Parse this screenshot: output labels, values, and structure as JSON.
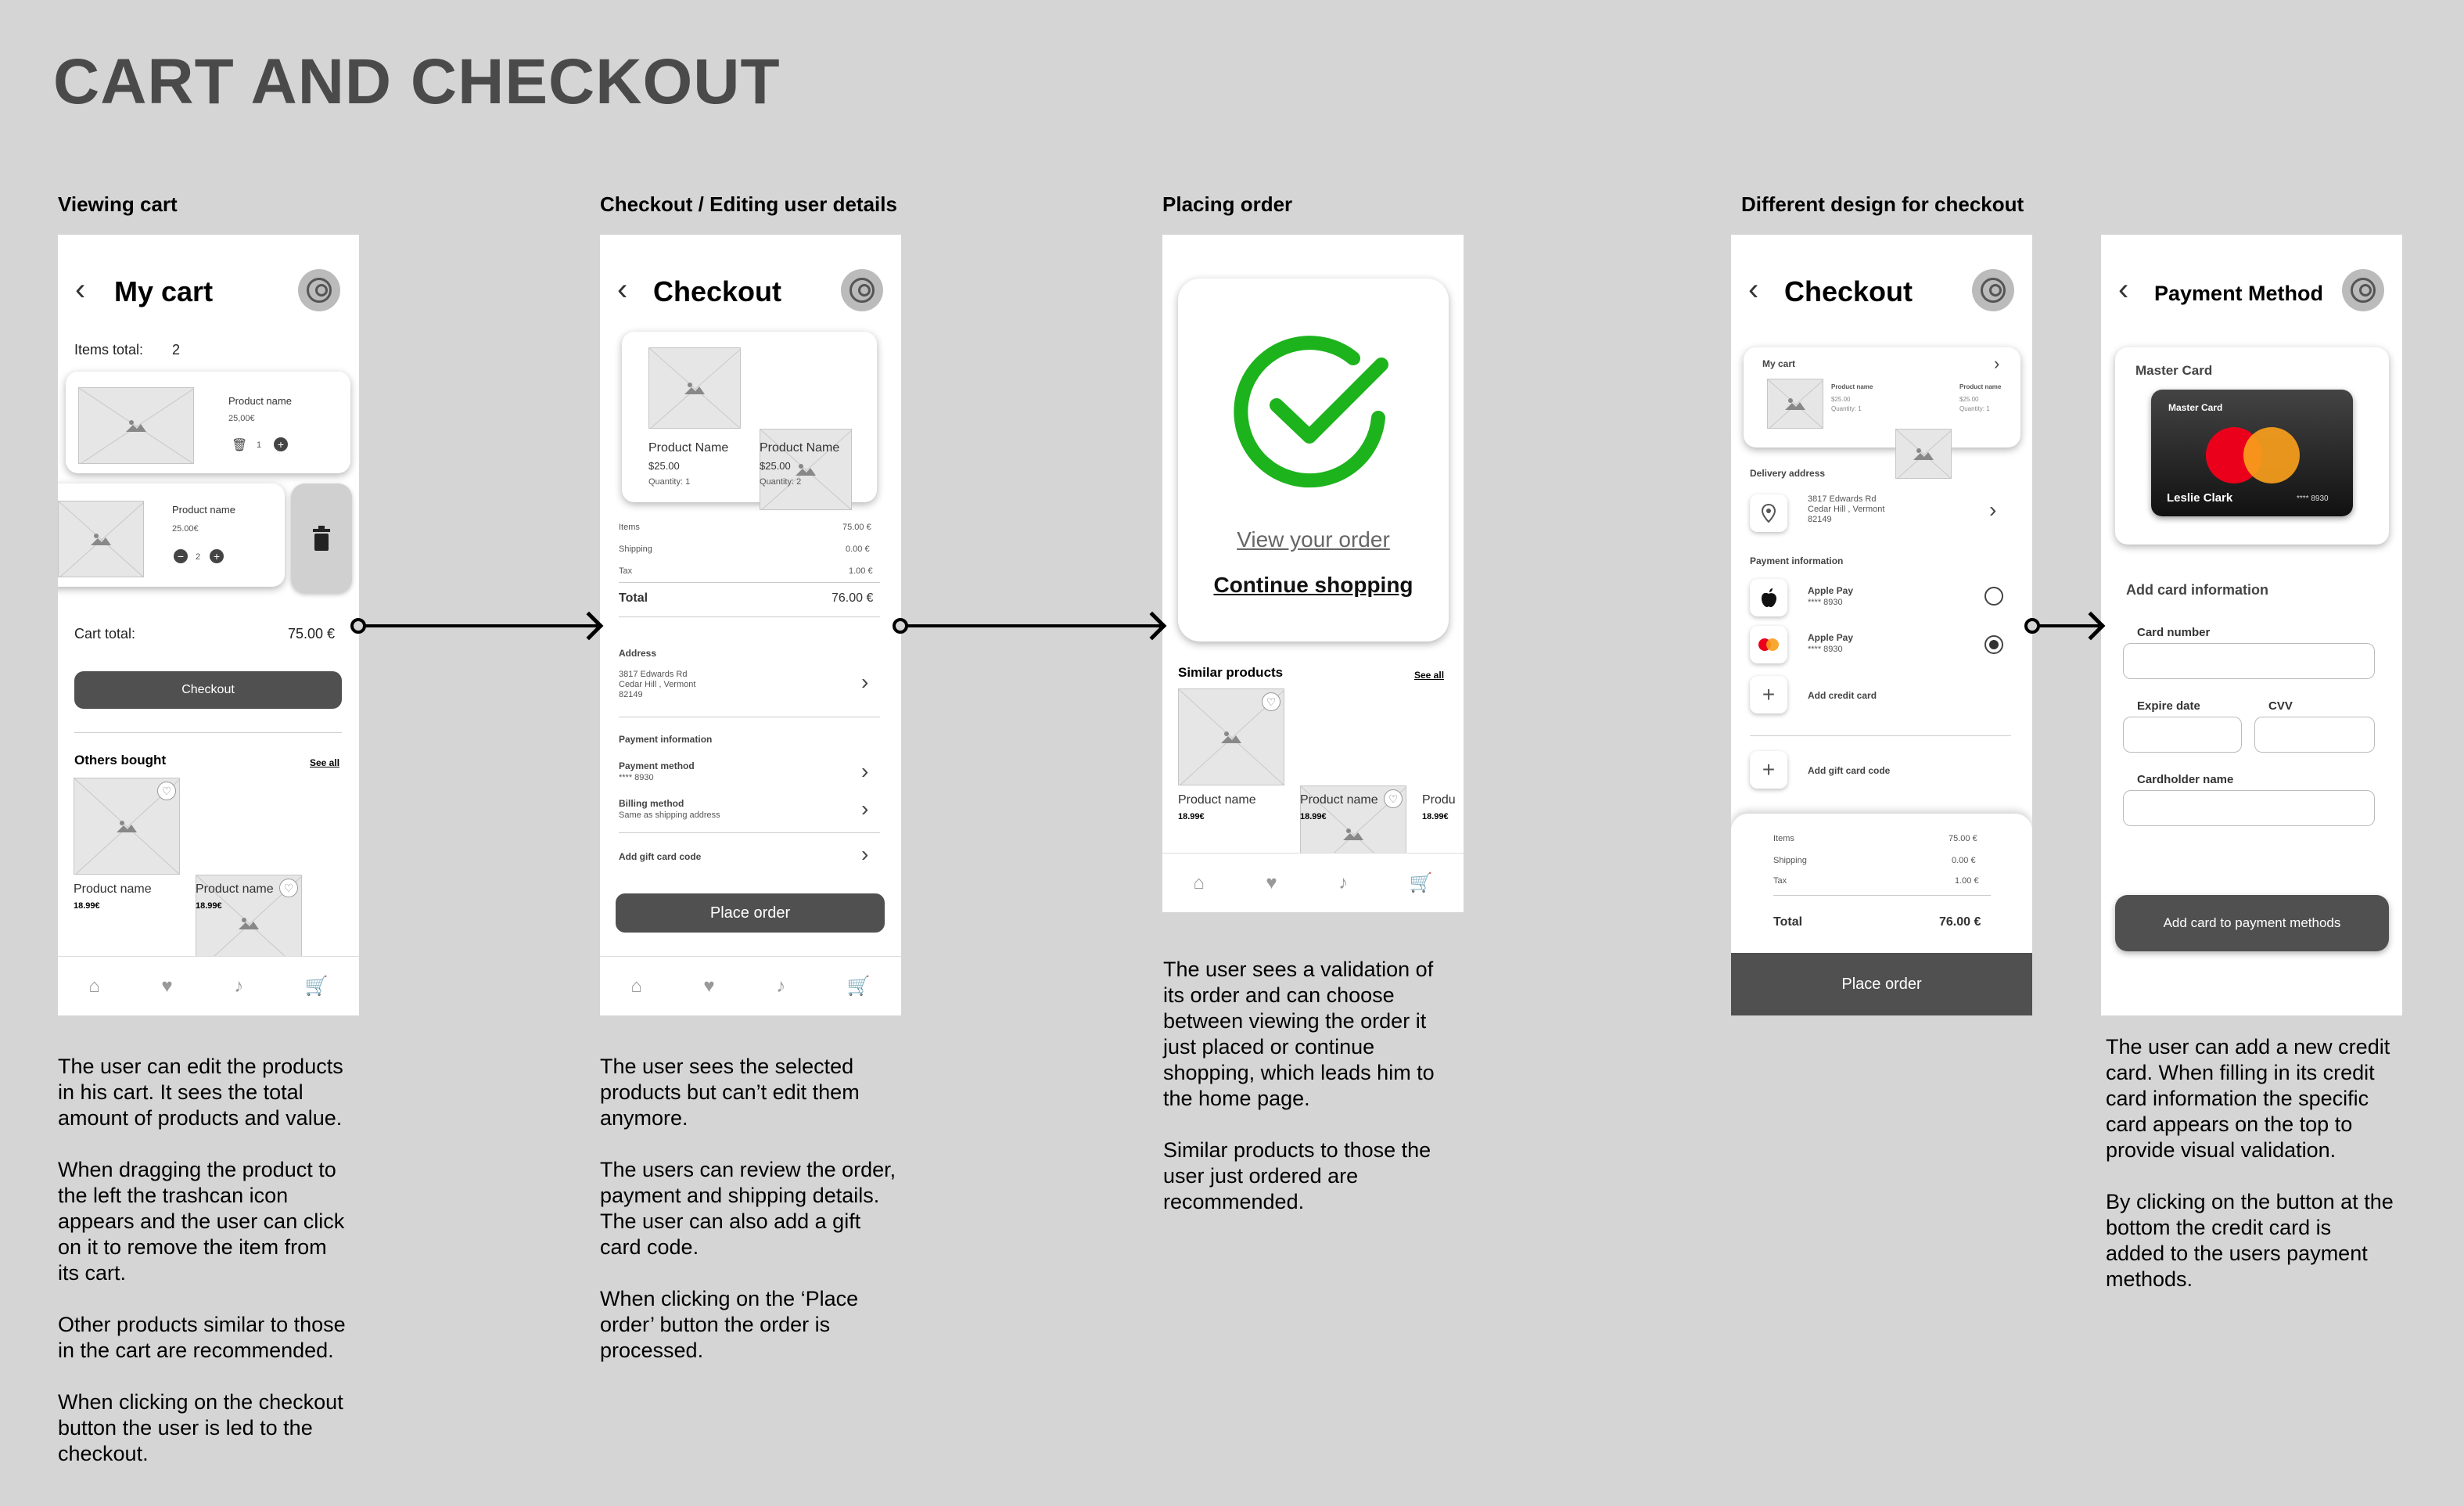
{
  "title": "CART AND CHECKOUT",
  "columns": {
    "c1": "Viewing cart",
    "c2": "Checkout / Editing user details",
    "c3": "Placing order",
    "c4": "Different design for checkout"
  },
  "cart": {
    "title": "My cart",
    "items_total_label": "Items total:",
    "items_total_value": "2",
    "item1": {
      "name": "Product name",
      "price": "25,00€",
      "qty": "1"
    },
    "item2": {
      "name": "Product name",
      "price": "25.00€",
      "qty": "2"
    },
    "cart_total_label": "Cart total:",
    "cart_total_value": "75.00 €",
    "checkout_button": "Checkout",
    "others_bought": "Others bought",
    "see_all": "See all",
    "rec1": {
      "name": "Product name",
      "price": "18.99€"
    },
    "rec2": {
      "name": "Product name",
      "price": "18.99€"
    }
  },
  "checkout": {
    "title": "Checkout",
    "p1": {
      "name": "Product Name",
      "price": "$25.00",
      "qty": "Quantity:  1"
    },
    "p2": {
      "name": "Product Name",
      "price": "$25.00",
      "qty": "Quantity:  2"
    },
    "items_label": "Items",
    "items_value": "75.00 €",
    "shipping_label": "Shipping",
    "shipping_value": "0.00 €",
    "tax_label": "Tax",
    "tax_value": "1.00 €",
    "total_label": "Total",
    "total_value": "76.00 €",
    "address_label": "Address",
    "address_lines": "3817 Edwards Rd\nCedar Hill , Vermont\n82149",
    "payment_info_label": "Payment information",
    "payment_method_label": "Payment method",
    "payment_method_value": "**** 8930",
    "billing_label": "Billing method",
    "billing_value": "Same as shipping address",
    "gift_label": "Add gift card code",
    "place_order": "Place order"
  },
  "placing": {
    "view_order": "View your order",
    "continue_shopping": "Continue shopping",
    "similar_label": "Similar products",
    "see_all": "See all",
    "s1": {
      "name": "Product name",
      "price": "18.99€"
    },
    "s2": {
      "name": "Product name",
      "price": "18.99€"
    },
    "s3": {
      "name": "Produ",
      "price": "18.99€"
    }
  },
  "checkout2": {
    "title": "Checkout",
    "my_cart": "My cart",
    "mini1": {
      "name": "Product name",
      "price": "$25.00",
      "qty": "Quantity:  1"
    },
    "mini2": {
      "name": "Product name",
      "price": "$25.00",
      "qty": "Quantity:  1"
    },
    "delivery_label": "Delivery address",
    "address_lines": "3817 Edwards Rd\nCedar Hill , Vermont\n82149",
    "payment_info_label": "Payment information",
    "pay1": {
      "name": "Apple Pay",
      "num": "**** 8930"
    },
    "pay2": {
      "name": "Apple Pay",
      "num": "**** 8930"
    },
    "add_credit": "Add credit card",
    "add_gift": "Add gift card code",
    "items_label": "Items",
    "items_value": "75.00 €",
    "shipping_label": "Shipping",
    "shipping_value": "0.00 €",
    "tax_label": "Tax",
    "tax_value": "1.00 €",
    "total_label": "Total",
    "total_value": "76.00 €",
    "place_order": "Place order"
  },
  "payment": {
    "title": "Payment Method",
    "master_card_label": "Master Card",
    "card_brand": "Master Card",
    "card_holder": "Leslie Clark",
    "card_number": "**** 8930",
    "add_info": "Add card information",
    "card_number_label": "Card number",
    "expire_label": "Expire date",
    "cvv_label": "CVV",
    "holder_label": "Cardholder name",
    "add_button": "Add card to payment methods"
  },
  "descriptions": {
    "d1": "The user can edit the products\nin his cart. It sees the total\namount of products and value.\n\nWhen dragging the product to\nthe left the trashcan icon\nappears and the user can click\non it to remove the item from\nits cart.\n\nOther products similar to those\nin the cart are recommended.\n\nWhen clicking on the checkout\nbutton the user is led to the\ncheckout.",
    "d2": "The user sees the selected\nproducts but can’t edit them\nanymore.\n\nThe users can review the order,\npayment and shipping details.\nThe user can also add a gift\ncard code.\n\nWhen clicking on the ‘Place\norder’ button the order is\nprocessed.",
    "d3": "The user sees a validation of\nits order and can choose\nbetween viewing the order it\njust placed or continue\nshopping, which leads him to\nthe home page.\n\nSimilar products to those the\nuser just ordered are\nrecommended.",
    "d4": "The user can add a new credit\ncard. When filling in its credit\ncard information the specific\ncard appears on the top to\nprovide visual validation.\n\nBy clicking on the button at the\nbottom the credit card is\nadded to the users payment\nmethods."
  },
  "colors": {
    "background": "#d5d5d5",
    "check_green": "#1db31d",
    "dark_button": "#505050"
  }
}
